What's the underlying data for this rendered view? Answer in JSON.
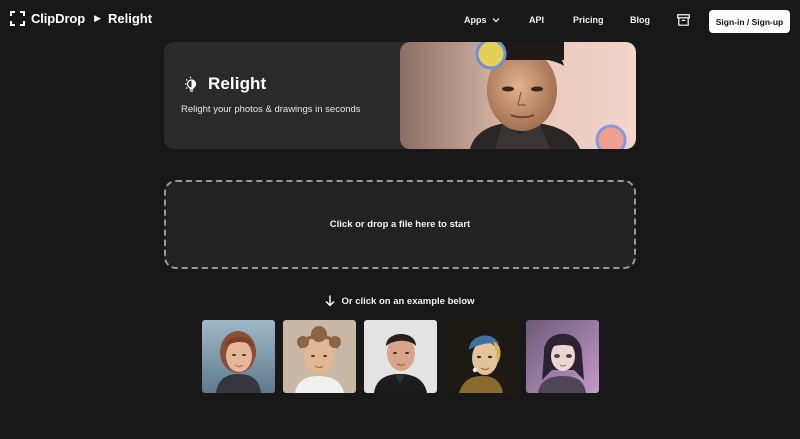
{
  "header": {
    "brand": "ClipDrop",
    "breadcrumb_sep": "▶",
    "current_page": "Relight",
    "nav": [
      {
        "label": "Apps",
        "has_dropdown": true
      },
      {
        "label": "API"
      },
      {
        "label": "Pricing"
      },
      {
        "label": "Blog"
      }
    ],
    "icons": {
      "logo": "clipdrop-logo-icon",
      "archive": "archive-box-icon",
      "chevron": "chevron-down-icon"
    },
    "signin_label": "Sign-in / Sign-up"
  },
  "hero": {
    "title": "Relight",
    "subtitle": "Relight your photos & drawings in seconds",
    "icon": "lightbulb-icon"
  },
  "dropzone": {
    "text": "Click or drop a file here to start"
  },
  "examples": {
    "hint": "Or click on an example below",
    "icon": "arrow-down-icon",
    "items": [
      {
        "name": "example-woman-redhead"
      },
      {
        "name": "example-young-man-curly-hair"
      },
      {
        "name": "example-man-dark-hair"
      },
      {
        "name": "example-girl-pearl-earring"
      },
      {
        "name": "example-anime-girl"
      }
    ]
  },
  "colors": {
    "background": "#181818",
    "card": "#2a2a2a",
    "dropzone": "#222222",
    "dropzone_border": "#9a9a9a",
    "text": "#ffffff",
    "button_bg": "#ffffff"
  }
}
